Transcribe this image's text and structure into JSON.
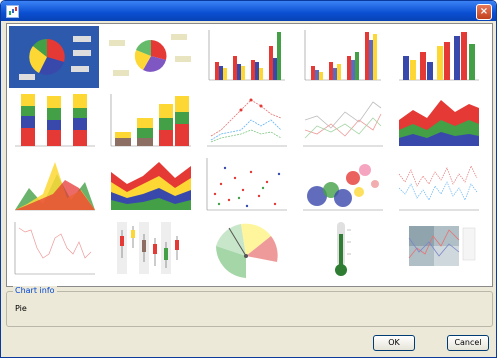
{
  "window": {
    "title": ""
  },
  "buttons": {
    "ok": "OK",
    "cancel": "Cancel",
    "close": "×"
  },
  "info": {
    "legend": "Chart info",
    "text": "Pie"
  },
  "colors": {
    "selection": "#2d5aad",
    "title_bar": "#0a4fd1",
    "dialog_bg": "#ece9d8"
  },
  "thumbnails": [
    {
      "name": "pie",
      "selected": true
    },
    {
      "name": "exploded-pie",
      "selected": false
    },
    {
      "name": "bar",
      "selected": false
    },
    {
      "name": "bar-3d",
      "selected": false
    },
    {
      "name": "bar-colored",
      "selected": false
    },
    {
      "name": "stacked-bar",
      "selected": false
    },
    {
      "name": "stacked-bar-3d",
      "selected": false
    },
    {
      "name": "line",
      "selected": false
    },
    {
      "name": "line-plain",
      "selected": false
    },
    {
      "name": "area",
      "selected": false
    },
    {
      "name": "area-layered",
      "selected": false
    },
    {
      "name": "stacked-area",
      "selected": false
    },
    {
      "name": "scatter",
      "selected": false
    },
    {
      "name": "bubble",
      "selected": false
    },
    {
      "name": "time-series",
      "selected": false
    },
    {
      "name": "price-line",
      "selected": false
    },
    {
      "name": "candlestick",
      "selected": false
    },
    {
      "name": "dial",
      "selected": false
    },
    {
      "name": "thermometer",
      "selected": false
    },
    {
      "name": "heatmap-overlay",
      "selected": false
    }
  ]
}
